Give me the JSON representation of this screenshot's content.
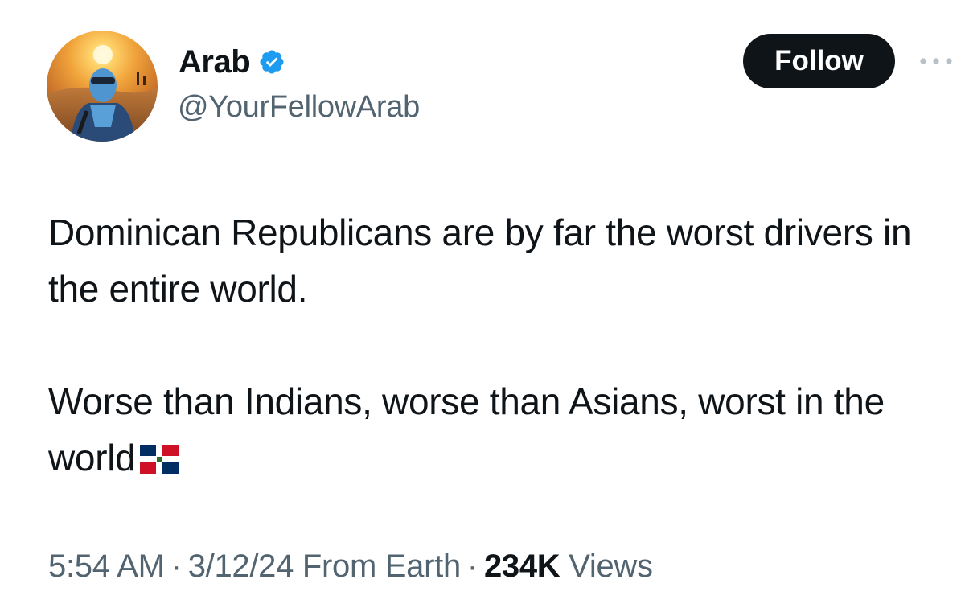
{
  "author": {
    "display_name": "Arab",
    "handle": "@YourFellowArab",
    "verified_icon": "verified-badge-icon"
  },
  "follow_button": {
    "label": "Follow"
  },
  "tweet": {
    "paragraphs": [
      "Dominican Republicans are by far the worst drivers in the entire world.",
      "Worse than Indians, worse than Asians, worst in the world"
    ],
    "emoji": "dominican-republic-flag-icon"
  },
  "meta": {
    "time": "5:54 AM",
    "separator": "·",
    "date_location": "3/12/24 From Earth",
    "views_count": "234K",
    "views_label": "Views"
  },
  "colors": {
    "text": "#0f1419",
    "secondary": "#536471",
    "verified": "#1d9bf0",
    "button_bg": "#0f1419"
  }
}
